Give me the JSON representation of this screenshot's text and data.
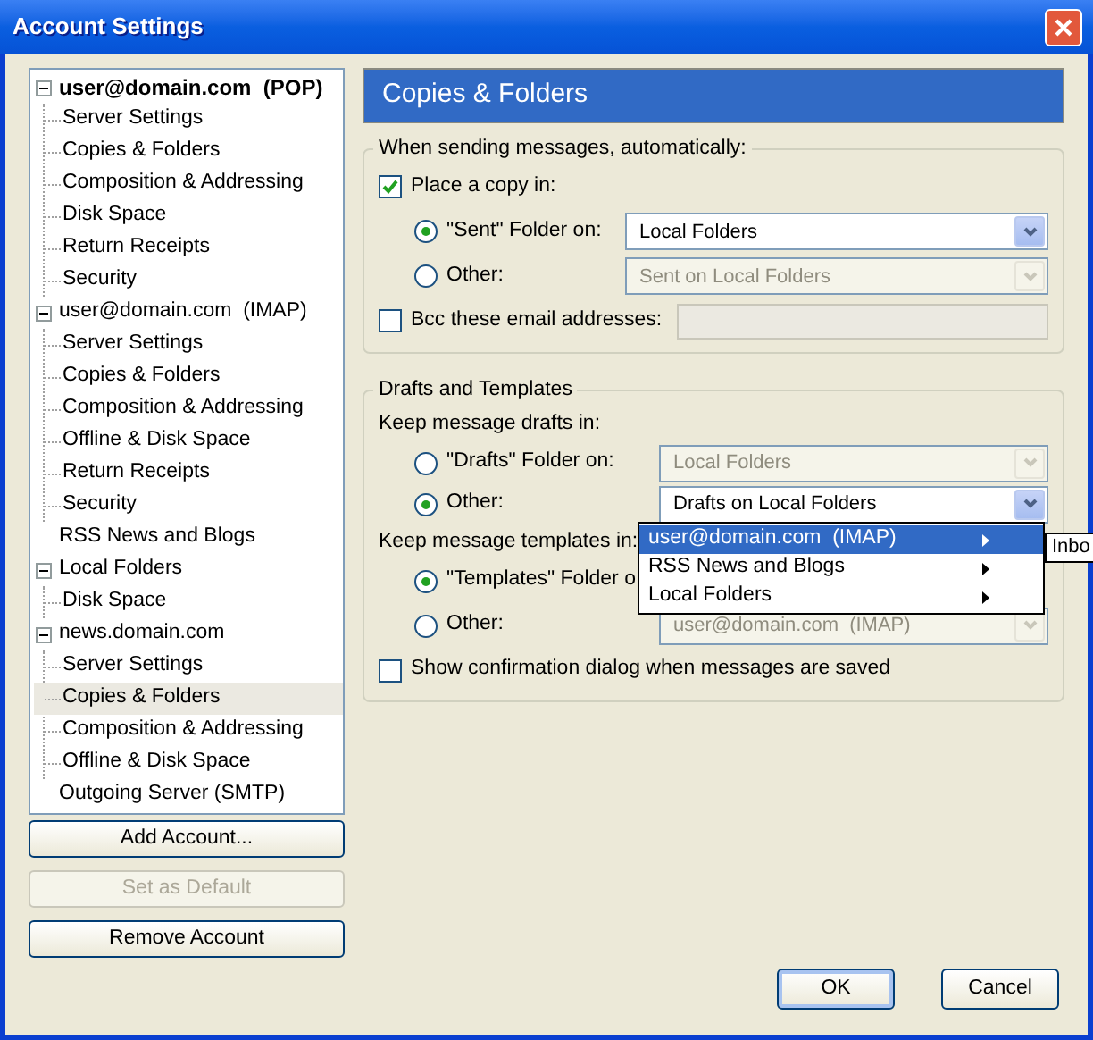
{
  "window": {
    "title": "Account Settings"
  },
  "tree": [
    {
      "label": "user@domain.com  (POP)",
      "is_default": true,
      "expanded": true,
      "selected": false,
      "children": [
        {
          "label": "Server Settings",
          "selected": false
        },
        {
          "label": "Copies & Folders",
          "selected": false
        },
        {
          "label": "Composition & Addressing",
          "selected": false
        },
        {
          "label": "Disk Space",
          "selected": false
        },
        {
          "label": "Return Receipts",
          "selected": false
        },
        {
          "label": "Security",
          "selected": false
        }
      ]
    },
    {
      "label": "user@domain.com  (IMAP)",
      "is_default": false,
      "expanded": true,
      "selected": false,
      "children": [
        {
          "label": "Server Settings",
          "selected": false
        },
        {
          "label": "Copies & Folders",
          "selected": false
        },
        {
          "label": "Composition & Addressing",
          "selected": false
        },
        {
          "label": "Offline & Disk Space",
          "selected": false
        },
        {
          "label": "Return Receipts",
          "selected": false
        },
        {
          "label": "Security",
          "selected": false
        }
      ]
    },
    {
      "label": "RSS News and Blogs",
      "is_default": false,
      "selected": false
    },
    {
      "label": "Local Folders",
      "is_default": false,
      "expanded": true,
      "selected": false,
      "children": [
        {
          "label": "Disk Space",
          "selected": false
        }
      ]
    },
    {
      "label": "news.domain.com",
      "is_default": false,
      "expanded": true,
      "selected": false,
      "children": [
        {
          "label": "Server Settings",
          "selected": false
        },
        {
          "label": "Copies & Folders",
          "selected": true
        },
        {
          "label": "Composition & Addressing",
          "selected": false
        },
        {
          "label": "Offline & Disk Space",
          "selected": false
        }
      ]
    },
    {
      "label": "Outgoing Server (SMTP)",
      "is_default": false,
      "selected": false
    }
  ],
  "account_buttons": [
    {
      "label": "Add Account...",
      "disabled": false
    },
    {
      "label": "Set as Default",
      "disabled": true
    },
    {
      "label": "Remove Account",
      "disabled": false
    }
  ],
  "page_title": "Copies & Folders",
  "groups": [
    {
      "legend": "When sending messages, automatically:",
      "rows": [
        {
          "kind": "checkbox",
          "label": "Place a copy in:",
          "checked": true
        },
        {
          "kind": "radio",
          "label": "\"Sent\" Folder on:",
          "selected": true,
          "combo": {
            "value": "Local Folders",
            "disabled": false
          }
        },
        {
          "kind": "radio",
          "label": "Other:",
          "selected": false,
          "combo": {
            "value": "Sent on Local Folders",
            "disabled": true
          }
        },
        {
          "kind": "checkbox",
          "label": "Bcc these email addresses:",
          "checked": false,
          "field": {
            "disabled": true
          }
        }
      ]
    },
    {
      "legend": "Drafts and Templates",
      "rows": [
        {
          "kind": "text",
          "label": "Keep message drafts in:"
        },
        {
          "kind": "radio",
          "label": "\"Drafts\" Folder on:",
          "selected": false,
          "combo": {
            "value": "Local Folders",
            "disabled": true
          }
        },
        {
          "kind": "radio",
          "label": "Other:",
          "selected": true,
          "combo": {
            "value": "Drafts on Local Folders",
            "disabled": false
          }
        },
        {
          "kind": "text",
          "label": "Keep message templates in:"
        },
        {
          "kind": "radio",
          "label": "\"Templates\" Folder o",
          "selected": true
        },
        {
          "kind": "radio",
          "label": "Other:",
          "selected": false,
          "combo": {
            "value": "user@domain.com  (IMAP)",
            "disabled": true
          }
        },
        {
          "kind": "checkbox",
          "label": "Show confirmation dialog when messages are saved",
          "checked": false
        }
      ]
    }
  ],
  "dropdown_menu": [
    {
      "label": "user@domain.com  (IMAP)",
      "selected": true
    },
    {
      "label": "RSS News and Blogs",
      "selected": false
    },
    {
      "label": "Local Folders",
      "selected": false
    }
  ],
  "submenu": [
    {
      "label": "Inbo"
    }
  ],
  "dialog_buttons": [
    {
      "label": "OK",
      "default": true
    },
    {
      "label": "Cancel",
      "default": false
    }
  ]
}
